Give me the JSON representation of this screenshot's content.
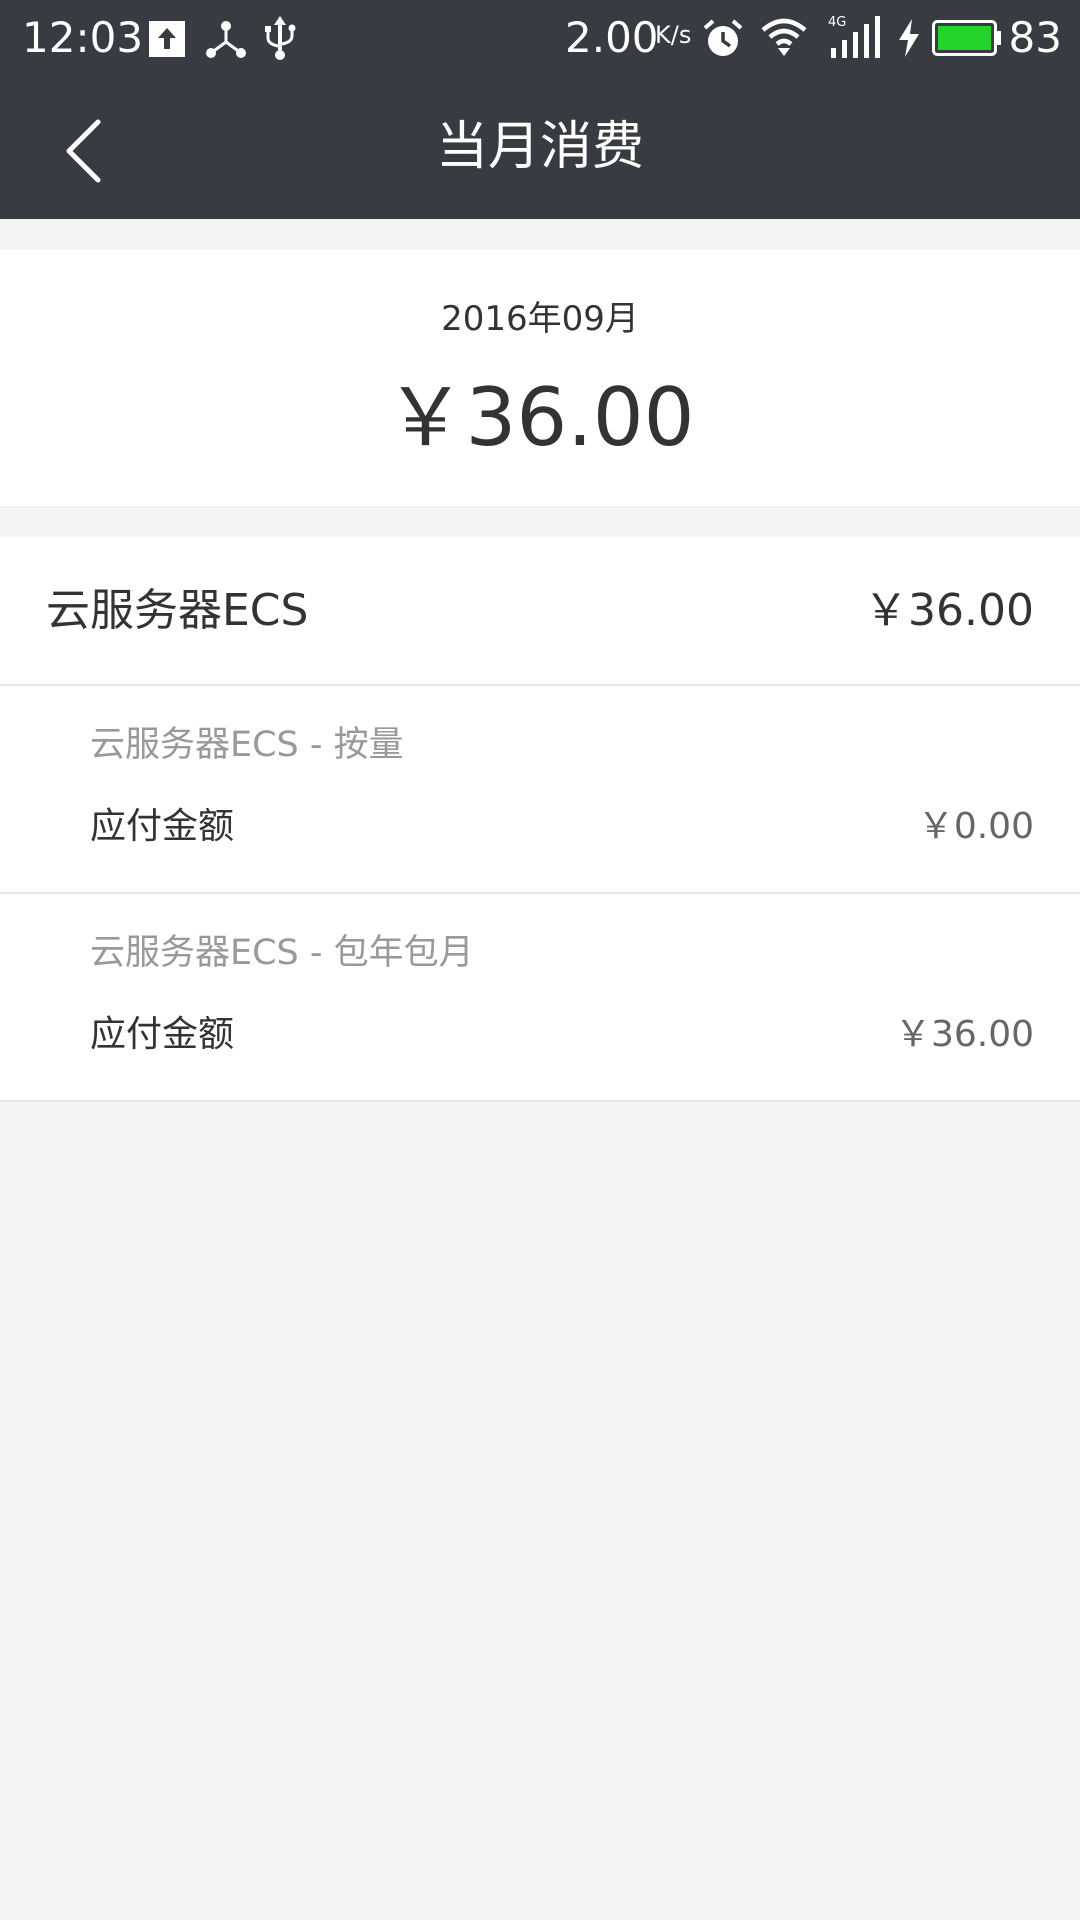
{
  "status_bar": {
    "time": "12:03",
    "net_speed": "2.00",
    "net_speed_unit": "K/s",
    "network_type": "4G",
    "battery_level": "83",
    "battery_color": "#22d42a",
    "icons": [
      "upload-icon",
      "share-icon",
      "usb-icon",
      "alarm-icon",
      "wifi-icon",
      "signal-icon",
      "charging-icon",
      "battery-icon"
    ]
  },
  "header": {
    "title": "当月消费",
    "back_icon": "chevron-left-icon",
    "background": "#383c42"
  },
  "summary": {
    "period": "2016年09月",
    "total": "￥36.00"
  },
  "product": {
    "name": "云服务器ECS",
    "amount": "￥36.00",
    "items": [
      {
        "name": "云服务器ECS - 按量",
        "label": "应付金额",
        "amount": "￥0.00"
      },
      {
        "name": "云服务器ECS - 包年包月",
        "label": "应付金额",
        "amount": "￥36.00"
      }
    ]
  }
}
